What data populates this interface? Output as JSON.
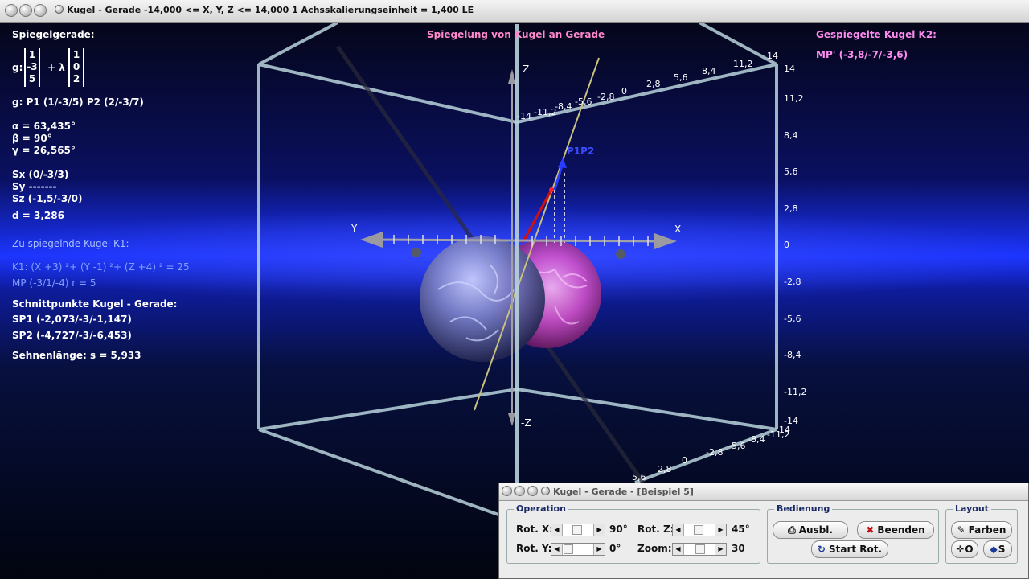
{
  "window": {
    "title": "Kugel - Gerade   -14,000 <= X, Y, Z <= 14,000    1 Achsskalierungseinheit = 1,400 LE"
  },
  "scene": {
    "heading": "Spiegelung von Kugel an Gerade",
    "axis_labels": {
      "x": "X",
      "y": "Y",
      "z": "Z",
      "neg_z": "-Z"
    },
    "vector_label": "P1P2",
    "z_ticks": [
      "14",
      "11,2",
      "8,4",
      "5,6",
      "2,8",
      "0",
      "-2,8",
      "-5,6",
      "-8,4",
      "-11,2",
      "-14"
    ],
    "top_ticks": [
      "-14",
      "-11,2",
      "-8,4",
      "-5,6",
      "-2,8",
      "0",
      "2,8",
      "5,6",
      "8,4",
      "11,2",
      "14"
    ],
    "bottom_ticks": [
      "14",
      "-11,2",
      "-8,4",
      "-5,6",
      "-2,8",
      "0",
      "2,8",
      "5,6"
    ],
    "colors": {
      "sphere_k1": "#8a90e0",
      "sphere_k2": "#e060d8",
      "line": "#c8c080",
      "frame": "#b9d3dc",
      "vector": "#2a3cff",
      "normal": "#d01010"
    }
  },
  "left_panel": {
    "spiegelgerade_title": "Spiegelgerade:",
    "g_prefix": "g:",
    "plus_lambda": "+ λ",
    "vec_a": [
      "1",
      "-3",
      "5"
    ],
    "vec_b": [
      "1",
      "0",
      "2"
    ],
    "points": "g: P1 (1/-3/5)    P2 (2/-3/7)",
    "alpha": "α = 63,435°",
    "beta": "β = 90°",
    "gamma": "γ = 26,565°",
    "sx": "Sx (0/-3/3)",
    "sy": "Sy -------",
    "sz": "Sz (-1,5/-3/0)",
    "d": "d = 3,286",
    "k1_title": "Zu spiegelnde Kugel K1:",
    "k1_eq": "K1: (X +3) ²+ (Y -1) ²+ (Z +4) ² = 25",
    "k1_mp": "MP (-3/1/-4)   r = 5",
    "schnitt_title": "Schnittpunkte Kugel - Gerade:",
    "sp1": "SP1 (-2,073/-3/-1,147)",
    "sp2": "SP2 (-4,727/-3/-6,453)",
    "sehne": "Sehnenlänge: s = 5,933"
  },
  "right_panel": {
    "title": "Gespiegelte Kugel K2:",
    "mp": "MP' (-3,8/-7/-3,6)"
  },
  "control_window": {
    "title": "Kugel - Gerade - [Beispiel 5]",
    "operation_label": "Operation",
    "bedienung_label": "Bedienung",
    "layout_label": "Layout",
    "rot_x_label": "Rot. X:",
    "rot_x_value": "90°",
    "rot_y_label": "Rot. Y:",
    "rot_y_value": "0°",
    "rot_z_label": "Rot. Z:",
    "rot_z_value": "45°",
    "zoom_label": "Zoom:",
    "zoom_value": "30",
    "ausbl_label": "Ausbl.",
    "beenden_label": "Beenden",
    "start_rot_label": "Start Rot.",
    "farben_label": "Farben",
    "o_label": "O",
    "s_label": "S"
  }
}
